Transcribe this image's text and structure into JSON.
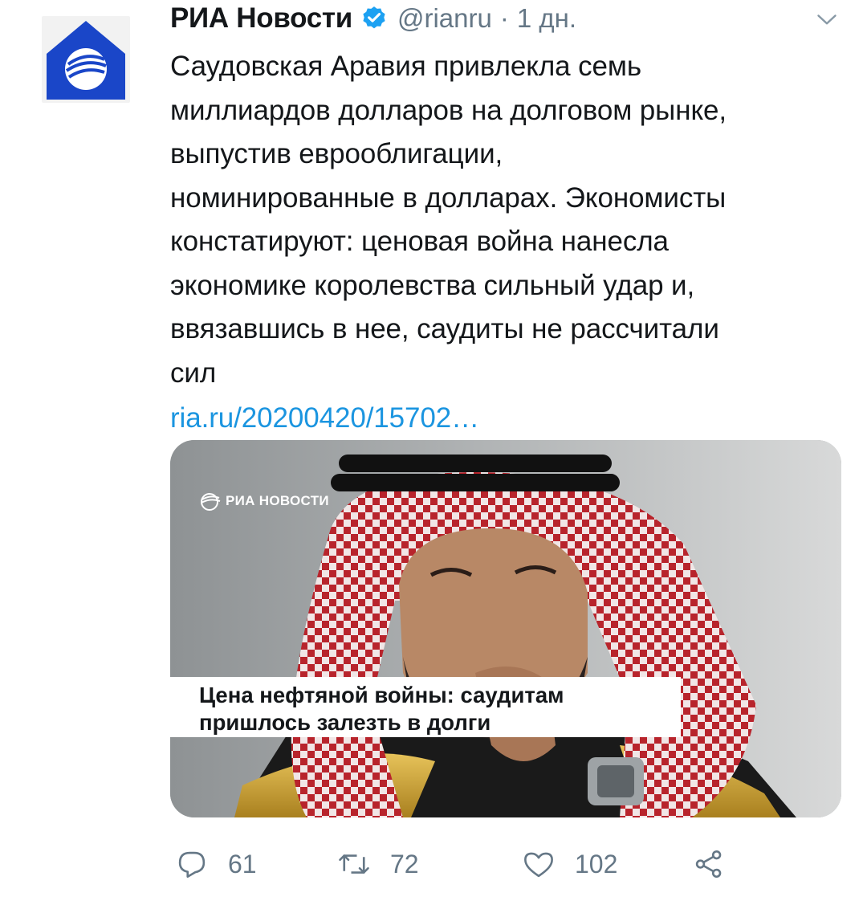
{
  "tweet": {
    "author_name": "РИА Новости",
    "handle": "@rianru",
    "separator": "·",
    "time": "1 дн.",
    "text_lines": [
      "Саудовская Аравия привлекла семь",
      "миллиардов долларов на долговом рынке,",
      "выпустив еврооблигации,",
      "номинированные в долларах. Экономисты",
      "констатируют: ценовая война нанесла",
      "экономике королевства сильный удар и,",
      "ввязавшись в нее, саудиты не рассчитали",
      "сил"
    ],
    "link": "ria.ru/20200420/15702…"
  },
  "card": {
    "watermark": "РИА НОВОСТИ",
    "headline_lines": [
      "Цена нефтяной войны: саудитам",
      "пришлось залезть в долги"
    ]
  },
  "actions": {
    "reply_count": "61",
    "retweet_count": "72",
    "like_count": "102"
  },
  "icons": {
    "avatar": "ria-logo-icon",
    "verified": "verified-badge-icon",
    "menu": "chevron-down-icon",
    "reply": "reply-icon",
    "retweet": "retweet-icon",
    "like": "heart-icon",
    "share": "share-icon"
  },
  "colors": {
    "brand_blue": "#1a46c8",
    "link": "#1b95e0",
    "secondary_text": "#657786",
    "verified": "#1da1f2"
  }
}
